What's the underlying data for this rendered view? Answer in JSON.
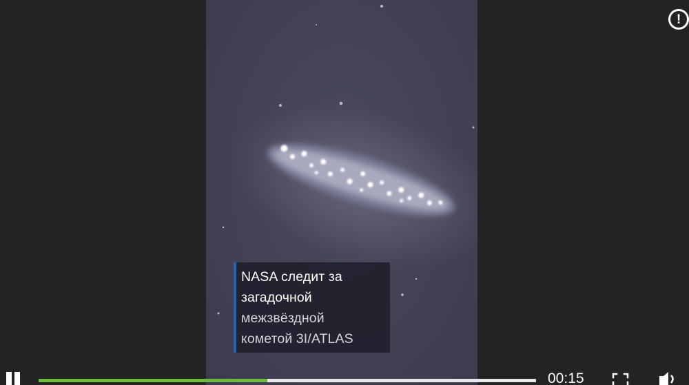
{
  "player": {
    "info_icon_glyph": "!",
    "caption": {
      "lines": [
        "NASA следит за",
        "загадочной",
        "межзвёздной",
        "кометой 3I/ATLAS"
      ]
    },
    "controls": {
      "pause_icon": "pause-icon",
      "progress_fraction": 0.46,
      "progress_color": "#6cbb3c",
      "time": "00:15",
      "fullscreen_icon": "fullscreen-icon",
      "volume_icon": "volume-icon"
    }
  }
}
